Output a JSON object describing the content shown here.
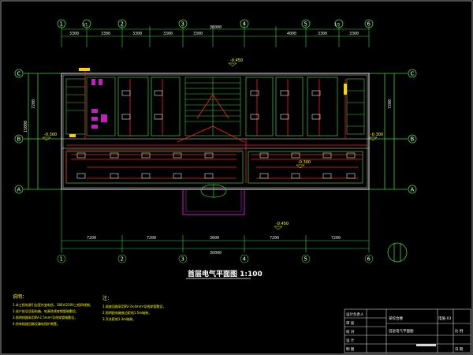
{
  "drawing": {
    "title": "首层电气平面图 1:100",
    "overall_dimension": "36000",
    "col_axes": [
      "1",
      "2",
      "3",
      "4",
      "5",
      "6"
    ],
    "half_axes": [
      "1/1",
      "1/5"
    ],
    "row_axes": [
      "C",
      "B",
      "A"
    ],
    "top_dims": [
      "3300",
      "3300",
      "3300",
      "3300",
      "3300",
      "4000",
      "3300",
      "3300"
    ],
    "bottom_dims": [
      "7200",
      "7200",
      "3600",
      "7200",
      "7200"
    ],
    "side_dims": [
      "7200",
      "7200"
    ],
    "side_total": "15000",
    "level_marks": [
      "-0.450",
      "-0.300",
      "-0.300",
      "-0.300",
      "-0.450"
    ]
  },
  "notes": {
    "left_heading": "说明：",
    "left_lines": [
      "1.本工程电源引自室外变电所，380V/220V三相四线制，",
      "2.进户处设总配电箱，电源进线穿钢管暗敷设，",
      "3.照明线路采用BV-2.5mm²导线穿管暗敷设，",
      "4.所有插座回路设漏电保护装置。"
    ],
    "mid_heading": "注：",
    "mid_lines": [
      "1.插座回路采用BV-3×4mm²导线穿管敷设，",
      "2.照明配电箱底边距地1.5m暗装，",
      "3.开关距地1.3m暗装。"
    ]
  },
  "title_block": {
    "rows": [
      "设计负责人",
      "审 核",
      "校 对",
      "设 计",
      "制 图"
    ],
    "project": "某综合楼",
    "sheet_name": "首层电气平面图",
    "scale_label": "比 例",
    "drawing_no": "电施-03",
    "date_label": "日 期"
  }
}
